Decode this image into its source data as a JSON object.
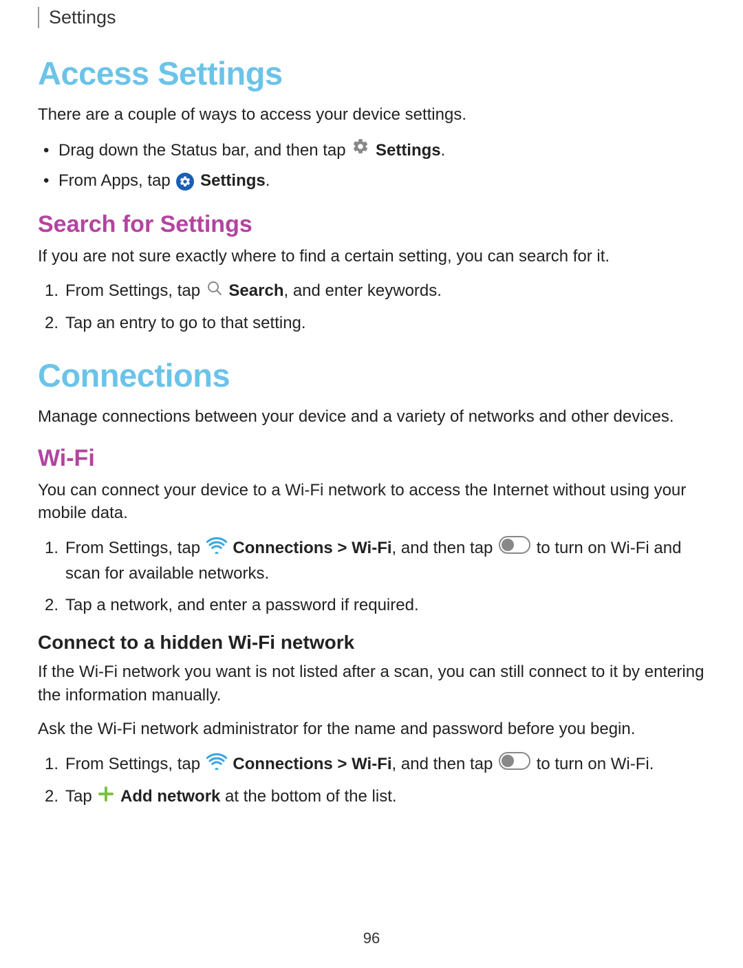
{
  "header": {
    "title": "Settings"
  },
  "sections": {
    "access": {
      "h1": "Access Settings",
      "intro": "There are a couple of ways to access your device settings.",
      "bullet1_a": "Drag down the Status bar, and then tap ",
      "bullet1_b": "Settings",
      "bullet1_c": ".",
      "bullet2_a": "From Apps, tap ",
      "bullet2_b": "Settings",
      "bullet2_c": "."
    },
    "search": {
      "h2": "Search for Settings",
      "intro": "If you are not sure exactly where to find a certain setting, you can search for it.",
      "step1_a": "From Settings, tap ",
      "step1_b": "Search",
      "step1_c": ", and enter keywords.",
      "step2": "Tap an entry to go to that setting."
    },
    "connections": {
      "h1": "Connections",
      "intro": "Manage connections between your device and a variety of networks and other devices."
    },
    "wifi": {
      "h2": "Wi-Fi",
      "intro": "You can connect your device to a Wi-Fi network to access the Internet without using your mobile data.",
      "step1_a": "From Settings, tap ",
      "step1_b": "Connections > Wi-Fi",
      "step1_c": ", and then tap ",
      "step1_d": " to turn on Wi-Fi and scan for available networks.",
      "step2": "Tap a network, and enter a password if required."
    },
    "hidden": {
      "h3": "Connect to a hidden Wi-Fi network",
      "intro": "If the Wi-Fi network you want is not listed after a scan, you can still connect to it by entering the information manually.",
      "intro2": "Ask the Wi-Fi network administrator for the name and password before you begin.",
      "step1_a": "From Settings, tap ",
      "step1_b": "Connections > Wi-Fi",
      "step1_c": ", and then tap ",
      "step1_d": " to turn on Wi-Fi.",
      "step2_a": "Tap ",
      "step2_b": "Add network",
      "step2_c": " at the bottom of the list."
    }
  },
  "pageNumber": "96"
}
